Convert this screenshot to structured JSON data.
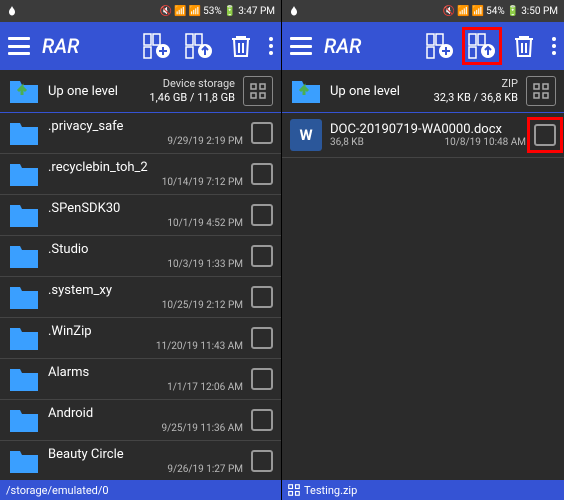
{
  "left": {
    "status": {
      "battery": "53%",
      "time": "3:47 PM"
    },
    "title": "RAR",
    "header": {
      "up": "Up one level",
      "storage_label": "Device storage",
      "storage_size": "1,46 GB / 11,8 GB"
    },
    "items": [
      {
        "name": ".privacy_safe",
        "date": "9/29/19 2:19 PM"
      },
      {
        "name": ".recyclebin_toh_2",
        "date": "10/14/19 7:12 PM"
      },
      {
        "name": ".SPenSDK30",
        "date": "10/1/19 4:52 PM"
      },
      {
        "name": ".Studio",
        "date": "10/3/19 1:33 PM"
      },
      {
        "name": ".system_xy",
        "date": "10/25/19 2:12 PM"
      },
      {
        "name": ".WinZip",
        "date": "11/20/19 11:43 AM"
      },
      {
        "name": "Alarms",
        "date": "1/1/17 12:06 AM"
      },
      {
        "name": "Android",
        "date": "9/25/19 11:36 AM"
      },
      {
        "name": "Beauty Circle",
        "date": "9/26/19 1:27 PM"
      }
    ],
    "path": "/storage/emulated/0"
  },
  "right": {
    "status": {
      "battery": "54%",
      "time": "3:50 PM"
    },
    "title": "RAR",
    "header": {
      "up": "Up one level",
      "storage_label": "ZIP",
      "storage_size": "32,3 KB / 36,8 KB"
    },
    "items": [
      {
        "name": "DOC-20190719-WA0000.docx",
        "size": "36,8 KB",
        "date": "10/8/19 10:48 AM",
        "letter": "W"
      }
    ],
    "path": "Testing.zip"
  }
}
